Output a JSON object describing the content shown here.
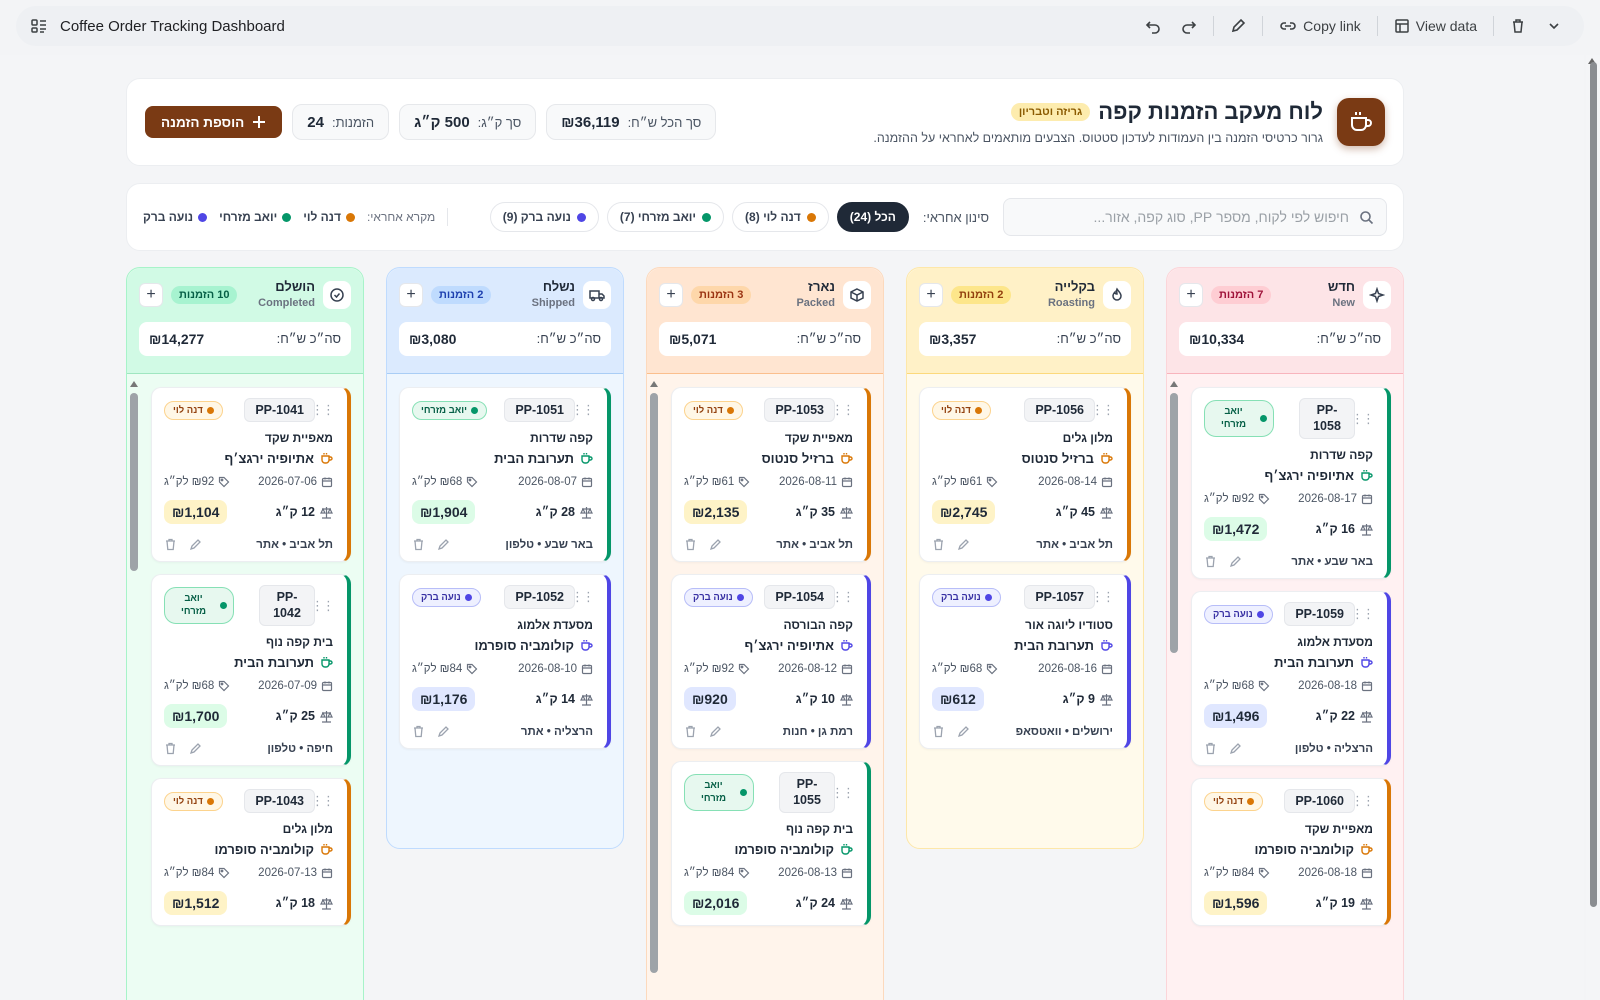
{
  "window": {
    "title": "Coffee Order Tracking Dashboard",
    "copy_link": "Copy link",
    "view_data": "View data"
  },
  "colors": {
    "brand": "#7a3a14",
    "dana": "#d97706",
    "yoav": "#059669",
    "noa": "#4f46e5"
  },
  "header": {
    "title": "לוח מעקב הזמנות קפה",
    "badge": "גריזה וטבריון",
    "subtitle": "גרור כרטיסי הזמנה בין העמודות לעדכון סטטוס. הצבעים מותאמים לאחראי על ההזמנה.",
    "stats": [
      {
        "label": "סך הכל ש״ח:",
        "value": "₪36,119"
      },
      {
        "label": "סך ק״ג:",
        "value": "500 ק״ג"
      },
      {
        "label": "הזמנות:",
        "value": "24"
      }
    ],
    "add_button": "הוספת הזמנה"
  },
  "filters": {
    "search_placeholder": "חיפוש לפי לקוח, מספר PP, סוג קפה, אזור...",
    "label": "סינון אחראי:",
    "chips": [
      {
        "label": "הכל (24)",
        "active": true
      },
      {
        "label": "דנה לוי (8)",
        "color": "#d97706"
      },
      {
        "label": "יואב מזרחי (7)",
        "color": "#059669"
      },
      {
        "label": "נועה ברק (9)",
        "color": "#4f46e5"
      }
    ],
    "legend_title": "מקרא אחראי:",
    "legend": [
      {
        "label": "דנה לוי",
        "color": "#d97706"
      },
      {
        "label": "יואב מזרחי",
        "color": "#059669"
      },
      {
        "label": "נועה ברק",
        "color": "#4f46e5"
      }
    ]
  },
  "columns": [
    {
      "he": "חדש",
      "en": "New",
      "icon": "sparkle-icon",
      "count": "7 הזמנות",
      "total_label": "סה״כ ש״ח:",
      "total": "₪10,334",
      "cards": [
        {
          "id": "PP-1058",
          "owner": "יואב מזרחי",
          "owner_key": "yoav",
          "customer": "קפה שדרות",
          "coffee": "אתיופיה ירגצ׳ף",
          "date": "2026-08-17",
          "ppk": "₪92 לק״ג",
          "kg": "16 ק״ג",
          "price": "₪1,472",
          "foot": "באר שבע • אתר"
        },
        {
          "id": "PP-1059",
          "owner": "נועה ברק",
          "owner_key": "noa",
          "customer": "מסעדת אלמוג",
          "coffee": "תערובת הבית",
          "date": "2026-08-18",
          "ppk": "₪68 לק״ג",
          "kg": "22 ק״ג",
          "price": "₪1,496",
          "foot": "הרצליה • טלפון"
        },
        {
          "id": "PP-1060",
          "owner": "דנה לוי",
          "owner_key": "dana",
          "customer": "מאפיית שקד",
          "coffee": "קולומביה סופרמו",
          "date": "2026-08-18",
          "ppk": "₪84 לק״ג",
          "kg": "19 ק״ג",
          "price": "₪1,596",
          "foot": ""
        }
      ]
    },
    {
      "he": "בקלייה",
      "en": "Roasting",
      "icon": "flame-icon",
      "count": "2 הזמנות",
      "total_label": "סה״כ ש״ח:",
      "total": "₪3,357",
      "cards": [
        {
          "id": "PP-1056",
          "owner": "דנה לוי",
          "owner_key": "dana",
          "customer": "מלון גלים",
          "coffee": "ברזיל סנטוס",
          "date": "2026-08-14",
          "ppk": "₪61 לק״ג",
          "kg": "45 ק״ג",
          "price": "₪2,745",
          "foot": "תל אביב • אתר"
        },
        {
          "id": "PP-1057",
          "owner": "נועה ברק",
          "owner_key": "noa",
          "customer": "סטודיו ליוגה אור",
          "coffee": "תערובת הבית",
          "date": "2026-08-16",
          "ppk": "₪68 לק״ג",
          "kg": "9 ק״ג",
          "price": "₪612",
          "foot": "ירושלים • וואטסאפ"
        }
      ]
    },
    {
      "he": "נארז",
      "en": "Packed",
      "icon": "box-icon",
      "count": "3 הזמנות",
      "total_label": "סה״כ ש״ח:",
      "total": "₪5,071",
      "cards": [
        {
          "id": "PP-1053",
          "owner": "דנה לוי",
          "owner_key": "dana",
          "customer": "מאפיית שקד",
          "coffee": "ברזיל סנטוס",
          "date": "2026-08-11",
          "ppk": "₪61 לק״ג",
          "kg": "35 ק״ג",
          "price": "₪2,135",
          "foot": "תל אביב • אתר"
        },
        {
          "id": "PP-1054",
          "owner": "נועה ברק",
          "owner_key": "noa",
          "customer": "קפה הבורסה",
          "coffee": "אתיופיה ירגצ׳ף",
          "date": "2026-08-12",
          "ppk": "₪92 לק״ג",
          "kg": "10 ק״ג",
          "price": "₪920",
          "foot": "רמת גן • חנות"
        },
        {
          "id": "PP-1055",
          "owner": "יואב מזרחי",
          "owner_key": "yoav",
          "customer": "בית קפה נוף",
          "coffee": "קולומביה סופרמו",
          "date": "2026-08-13",
          "ppk": "₪84 לק״ג",
          "kg": "24 ק״ג",
          "price": "₪2,016",
          "foot": ""
        }
      ]
    },
    {
      "he": "נשלח",
      "en": "Shipped",
      "icon": "truck-icon",
      "count": "2 הזמנות",
      "total_label": "סה״כ ש״ח:",
      "total": "₪3,080",
      "cards": [
        {
          "id": "PP-1051",
          "owner": "יואב מזרחי",
          "owner_key": "yoav",
          "customer": "קפה שדרות",
          "coffee": "תערובת הבית",
          "date": "2026-08-07",
          "ppk": "₪68 לק״ג",
          "kg": "28 ק״ג",
          "price": "₪1,904",
          "foot": "באר שבע • טלפון"
        },
        {
          "id": "PP-1052",
          "owner": "נועה ברק",
          "owner_key": "noa",
          "customer": "מסעדת אלמוג",
          "coffee": "קולומביה סופרמו",
          "date": "2026-08-10",
          "ppk": "₪84 לק״ג",
          "kg": "14 ק״ג",
          "price": "₪1,176",
          "foot": "הרצליה • אתר"
        }
      ]
    },
    {
      "he": "הושלם",
      "en": "Completed",
      "icon": "check-circle-icon",
      "count": "10 הזמנות",
      "total_label": "סה״כ ש״ח:",
      "total": "₪14,277",
      "cards": [
        {
          "id": "PP-1041",
          "owner": "דנה לוי",
          "owner_key": "dana",
          "customer": "מאפיית שקד",
          "coffee": "אתיופיה ירגצ׳ף",
          "date": "2026-07-06",
          "ppk": "₪92 לק״ג",
          "kg": "12 ק״ג",
          "price": "₪1,104",
          "foot": "תל אביב • אתר"
        },
        {
          "id": "PP-1042",
          "owner": "יואב מזרחי",
          "owner_key": "yoav",
          "customer": "בית קפה נוף",
          "coffee": "תערובת הבית",
          "date": "2026-07-09",
          "ppk": "₪68 לק״ג",
          "kg": "25 ק״ג",
          "price": "₪1,700",
          "foot": "חיפה • טלפון"
        },
        {
          "id": "PP-1043",
          "owner": "דנה לוי",
          "owner_key": "dana",
          "customer": "מלון גלים",
          "coffee": "קולומביה סופרמו",
          "date": "2026-07-13",
          "ppk": "₪84 לק״ג",
          "kg": "18 ק״ג",
          "price": "₪1,512",
          "foot": ""
        }
      ]
    }
  ]
}
